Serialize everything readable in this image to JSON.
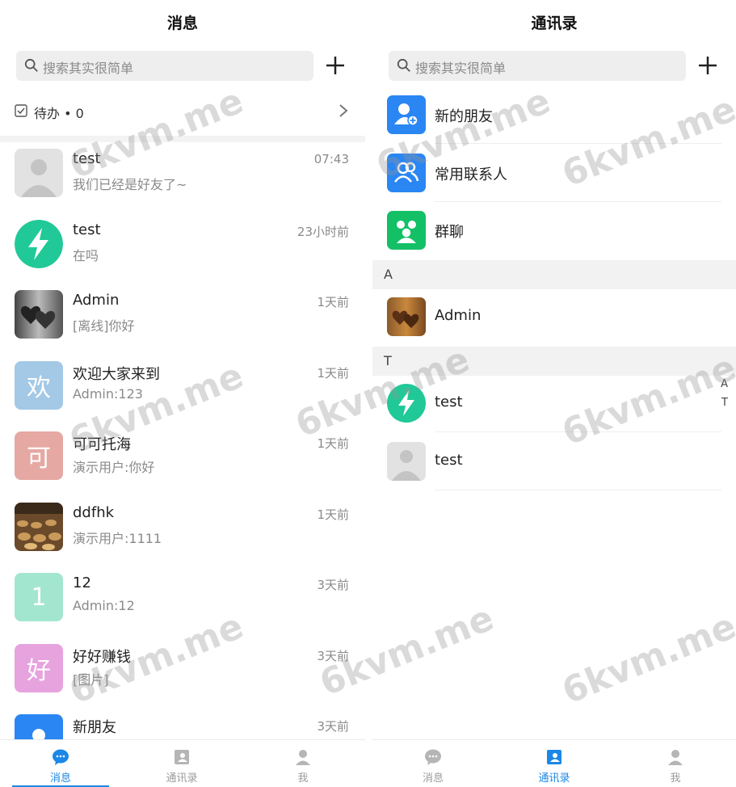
{
  "messages_screen": {
    "title": "消息",
    "search_placeholder": "搜索其实很简单",
    "todo_label": "待办 • 0",
    "chats": [
      {
        "name": "test",
        "message": "我们已经是好友了~",
        "time": "07:43",
        "avatar": "gray-person"
      },
      {
        "name": "test",
        "message": "在吗",
        "time": "23小时前",
        "avatar": "green-bolt"
      },
      {
        "name": "Admin",
        "message": "[离线]你好",
        "time": "1天前",
        "avatar": "hearts-dark"
      },
      {
        "name": "欢迎大家来到",
        "message": "Admin:123",
        "time": "1天前",
        "avatar": "letter",
        "letter": "欢",
        "color": "#a3c9e6"
      },
      {
        "name": "可可托海",
        "message": "演示用户:你好",
        "time": "1天前",
        "avatar": "letter",
        "letter": "可",
        "color": "#e6a8a3"
      },
      {
        "name": "ddfhk",
        "message": "演示用户:1111",
        "time": "1天前",
        "avatar": "food-photo"
      },
      {
        "name": "12",
        "message": "Admin:12",
        "time": "3天前",
        "avatar": "letter",
        "letter": "1",
        "color": "#a3e6d0"
      },
      {
        "name": "好好赚钱",
        "message": "[图片]",
        "time": "3天前",
        "avatar": "letter",
        "letter": "好",
        "color": "#e6a3de"
      },
      {
        "name": "新朋友",
        "message": "",
        "time": "3天前",
        "avatar": "blue-person"
      }
    ]
  },
  "contacts_screen": {
    "title": "通讯录",
    "search_placeholder": "搜索其实很简单",
    "entries": [
      {
        "label": "新的朋友",
        "icon": "add-friend-icon",
        "color": "#2a86f3"
      },
      {
        "label": "常用联系人",
        "icon": "contacts-icon",
        "color": "#2a86f3"
      },
      {
        "label": "群聊",
        "icon": "group-icon",
        "color": "#13c066"
      }
    ],
    "sections": [
      {
        "letter": "A",
        "contacts": [
          {
            "name": "Admin",
            "avatar": "hearts-wood"
          }
        ]
      },
      {
        "letter": "T",
        "contacts": [
          {
            "name": "test",
            "avatar": "green-bolt"
          },
          {
            "name": "test",
            "avatar": "gray-person"
          }
        ]
      }
    ],
    "index_letters": [
      "A",
      "T"
    ]
  },
  "tabbar": {
    "tabs": [
      {
        "label": "消息",
        "icon": "chat-bubble-icon"
      },
      {
        "label": "通讯录",
        "icon": "address-book-icon"
      },
      {
        "label": "我",
        "icon": "user-icon"
      }
    ],
    "left_active": 0,
    "right_active": 1
  },
  "watermark": "6kvm.me",
  "colors": {
    "accent": "#1b87e6",
    "green": "#20c997"
  }
}
